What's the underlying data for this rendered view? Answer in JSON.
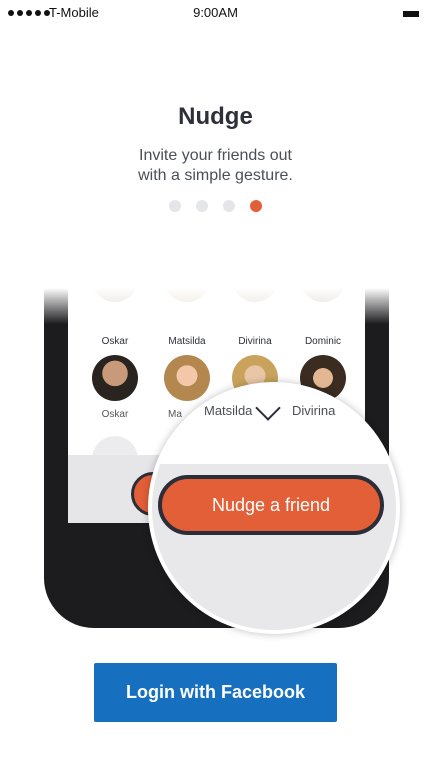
{
  "status_bar": {
    "carrier": "T-Mobile",
    "time": "9:00AM"
  },
  "onboarding": {
    "title": "Nudge",
    "subtitle_line1": "Invite your friends out",
    "subtitle_line2": "with a simple gesture.",
    "page_indicator": {
      "total": 4,
      "active": 4
    }
  },
  "phone": {
    "row1_names": [
      "Oskar",
      "Matsilda",
      "Divirina",
      "Dominic"
    ],
    "row2_names": [
      "Oskar",
      "Ma"
    ],
    "magnified_names": [
      "Matsilda",
      "Divirina"
    ],
    "nudge_button": "Nudge a friend"
  },
  "login_button": "Login with Facebook",
  "colors": {
    "accent": "#e35f37",
    "facebook_blue": "#1670bf",
    "dark": "#2d3038"
  }
}
